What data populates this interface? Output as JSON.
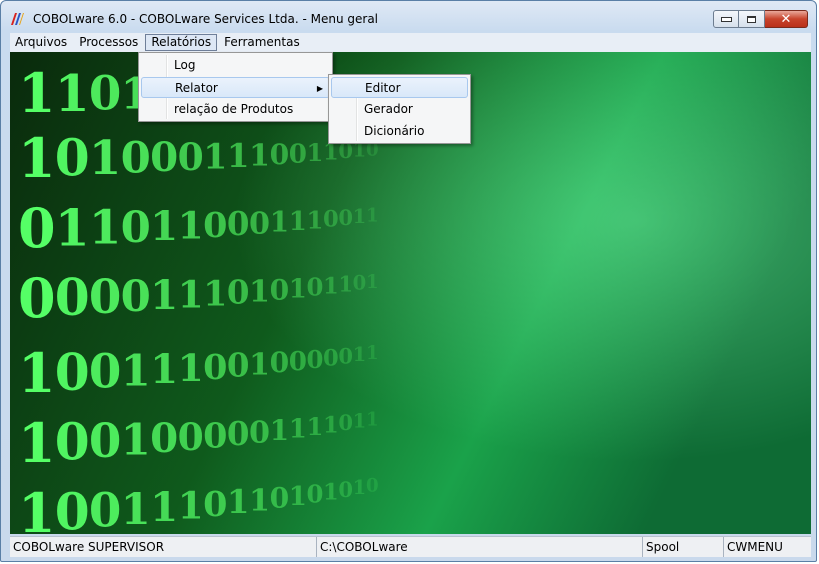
{
  "window": {
    "title": "COBOLware 6.0 - COBOLware Services Ltda. - Menu geral"
  },
  "menubar": [
    "Arquivos",
    "Processos",
    "Relatórios",
    "Ferramentas"
  ],
  "relatorios_menu": {
    "items": [
      "Log",
      "Relator",
      "relação de Produtos"
    ]
  },
  "relator_submenu": {
    "items": [
      "Editor",
      "Gerador",
      "Dicionário"
    ]
  },
  "statusbar": {
    "user": "COBOLware SUPERVISOR",
    "path": "C:\\COBOLware",
    "spool": "Spool",
    "program": "CWMENU"
  },
  "background": {
    "rows": [
      "1101001011100",
      "1010001110011010",
      "0110110001110011",
      "0000111010101101",
      "1001110010000011",
      "1001000001111011",
      "1001110110101010"
    ]
  },
  "colors": {
    "accent_green": "#55ff66",
    "menu_highlight": "#d9e8f9",
    "close_red": "#c8432b"
  }
}
